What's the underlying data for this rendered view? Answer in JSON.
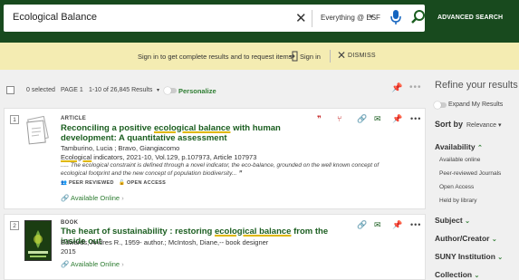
{
  "search": {
    "query": "Ecological Balance",
    "scope": "Everything @ ESF",
    "advanced_label": "ADVANCED SEARCH"
  },
  "banner": {
    "message": "Sign in to get complete results and to request items",
    "signin_label": "Sign in",
    "dismiss_label": "DISMISS"
  },
  "toolbar": {
    "selected": "0 selected",
    "page": "PAGE 1",
    "range": "1-10 of 26,845 Results",
    "personalize_label": "Personalize"
  },
  "results": [
    {
      "number": "1",
      "type": "ARTICLE",
      "title_pre": "Reconciling a positive ",
      "title_hl": "ecological balance",
      "title_post": " with human development: A quantitative assessment",
      "authors": "Tamburino, Lucia ; Bravo, Giangiacomo",
      "source_hl": "Ecological",
      "source_rest": " indicators, 2021-10, Vol.129, p.107973, Article 107973",
      "snippet": "..... The ecological constraint is defined through a novel indicator, the eco-balance, grounded on the well known concept of ecological footprint and the new concept of population biodiversity...",
      "badges": [
        "PEER REVIEWED",
        "OPEN ACCESS"
      ],
      "availability": "Available Online"
    },
    {
      "number": "2",
      "type": "BOOK",
      "title_pre": "The heart of sustainability : restoring ",
      "title_hl": "ecological balance",
      "title_post": " from the inside out",
      "authors": "Edwards, Andres R., 1959- author.; McIntosh, Diane,-- book designer",
      "year": "2015",
      "availability": "Available Online"
    }
  ],
  "sidebar": {
    "refine_title": "Refine your results",
    "expand_label": "Expand My Results",
    "sort_label": "Sort by",
    "sort_value": "Relevance",
    "availability_label": "Availability",
    "availability_items": [
      "Available online",
      "Peer-reviewed Journals",
      "Open Access",
      "Held by library"
    ],
    "facets": [
      "Subject",
      "Author/Creator",
      "SUNY Institution",
      "Collection"
    ]
  },
  "colors": {
    "header_bg": "#184a1e",
    "banner_bg": "#f4ecb2",
    "accent_green": "#2e7d32",
    "highlight": "#e0b800",
    "citation_red": "#c62828"
  }
}
